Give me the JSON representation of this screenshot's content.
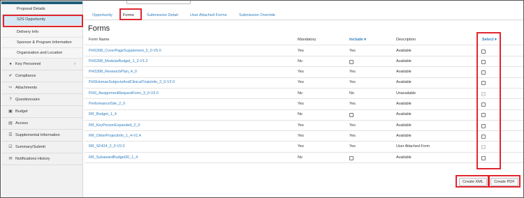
{
  "sidebar": {
    "sub_items": [
      {
        "label": "Proposal Details",
        "active": false
      },
      {
        "label": "S2S Opportunity",
        "active": true
      },
      {
        "label": "Delivery Info",
        "active": false
      },
      {
        "label": "Sponsor & Program Information",
        "active": false
      },
      {
        "label": "Organization and Location",
        "active": false
      }
    ],
    "main_items": [
      {
        "label": "Key Personnel",
        "icon": "person-icon",
        "glyph": "●",
        "has_chevron": true
      },
      {
        "label": "Compliance",
        "icon": "thumbs-up-icon",
        "glyph": "✔",
        "has_chevron": false
      },
      {
        "label": "Attachments",
        "icon": "paperclip-icon",
        "glyph": "✂",
        "has_chevron": false
      },
      {
        "label": "Questionnaire",
        "icon": "question-icon",
        "glyph": "?",
        "has_chevron": false
      },
      {
        "label": "Budget",
        "icon": "budget-icon",
        "glyph": "▣",
        "has_chevron": false
      },
      {
        "label": "Access",
        "icon": "lock-icon",
        "glyph": "▤",
        "has_chevron": false
      },
      {
        "label": "Supplemental Information",
        "icon": "list-icon",
        "glyph": "☰",
        "has_chevron": false
      },
      {
        "label": "Summary/Submit",
        "icon": "check-square-icon",
        "glyph": "☑",
        "has_chevron": false
      },
      {
        "label": "Notifications History",
        "icon": "mail-icon",
        "glyph": "✉",
        "has_chevron": false
      }
    ],
    "chevron": "›"
  },
  "tabs": [
    {
      "label": "Opportunity",
      "active": false
    },
    {
      "label": "Forms",
      "active": true
    },
    {
      "label": "Submission Detail",
      "active": false
    },
    {
      "label": "User Attached Forms",
      "active": false
    },
    {
      "label": "Submission Override",
      "active": false
    }
  ],
  "page_title": "Forms",
  "table": {
    "headers": {
      "form_name": "Form Name",
      "mandatory": "Mandatory",
      "include": "Include",
      "description": "Description",
      "select": "Select"
    },
    "sort_caret": "▾",
    "rows": [
      {
        "name": "PHS398_CoverPageSupplement_5_0-V5.0",
        "mandatory": "Yes",
        "include": "Yes",
        "description": "Available",
        "select_disabled": false
      },
      {
        "name": "PHS398_ModularBudget_1_2-V1.2",
        "mandatory": "No",
        "include": "checkbox",
        "description": "Available",
        "select_disabled": false
      },
      {
        "name": "PHS398_ResearchPlan_4_0",
        "mandatory": "Yes",
        "include": "Yes",
        "description": "Available",
        "select_disabled": false
      },
      {
        "name": "PHSHumanSubjectsAndClinicalTrialsInfo_2_0-V2.0",
        "mandatory": "Yes",
        "include": "Yes",
        "description": "Available",
        "select_disabled": false
      },
      {
        "name": "PHS_AssignmentRequestForm_3_0-V3.0",
        "mandatory": "No",
        "include": "No",
        "description": "Unavailable",
        "select_disabled": true
      },
      {
        "name": "PerformanceSite_2_0",
        "mandatory": "Yes",
        "include": "Yes",
        "description": "Available",
        "select_disabled": false
      },
      {
        "name": "RR_Budget_1_4",
        "mandatory": "No",
        "include": "checkbox",
        "description": "Available",
        "select_disabled": false
      },
      {
        "name": "RR_KeyPersonExpanded_2_0",
        "mandatory": "Yes",
        "include": "Yes",
        "description": "Available",
        "select_disabled": false
      },
      {
        "name": "RR_OtherProjectInfo_1_4-V1.4",
        "mandatory": "Yes",
        "include": "Yes",
        "description": "Available",
        "select_disabled": false
      },
      {
        "name": "RR_SF424_2_0-V2.0",
        "mandatory": "Yes",
        "include": "Yes",
        "description": "User Attached Form",
        "select_disabled": true
      },
      {
        "name": "RR_SubawardBudget30_1_4",
        "mandatory": "No",
        "include": "checkbox",
        "description": "Available",
        "select_disabled": false
      }
    ]
  },
  "buttons": {
    "create_xml": "Create XML",
    "create_pdf": "Create PDF"
  }
}
